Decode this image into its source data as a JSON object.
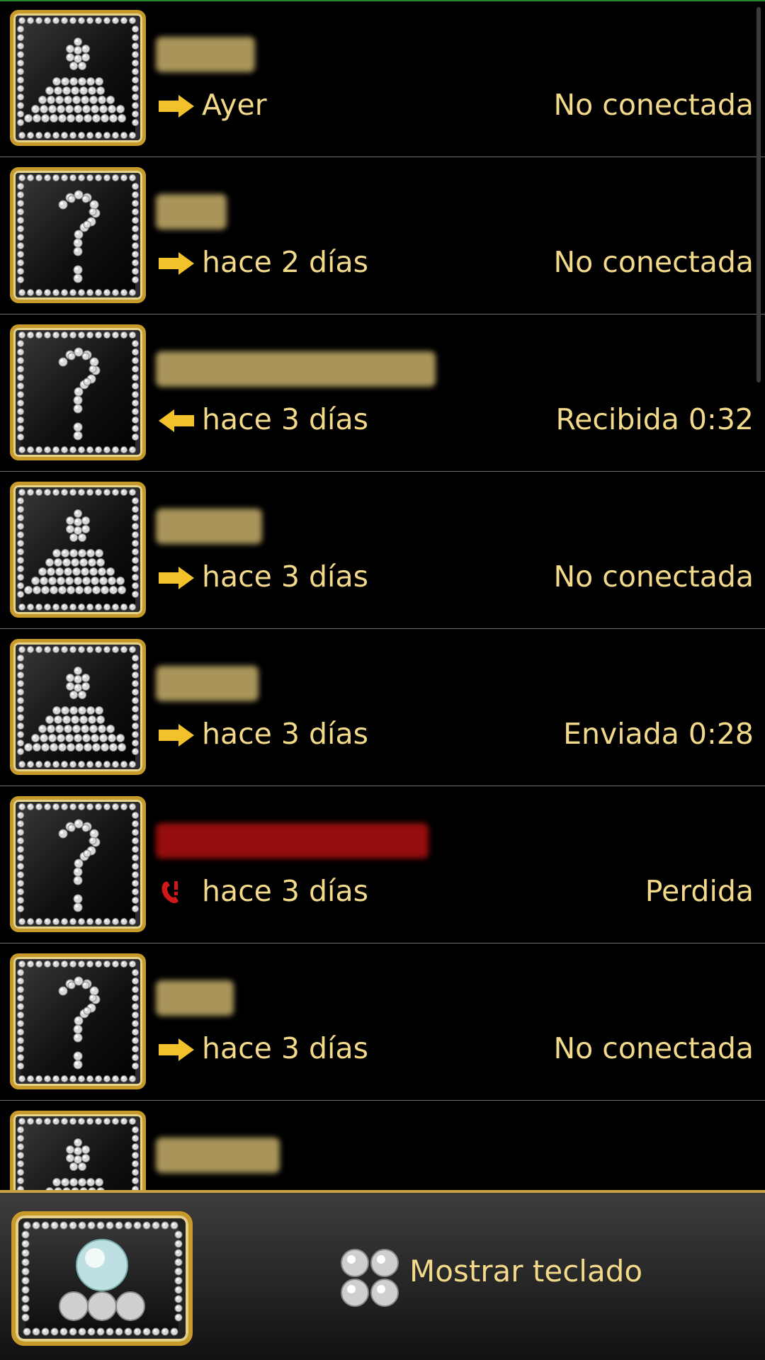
{
  "calls": [
    {
      "time": "Ayer",
      "status": "No conectada",
      "type": "outgoing",
      "avatar": "person-icon",
      "name_color": "#c7b06a"
    },
    {
      "time": "hace 2 días",
      "status": "No conectada",
      "type": "outgoing",
      "avatar": "unknown-icon",
      "name_color": "#c7b06a"
    },
    {
      "time": "hace 3 días",
      "status": "Recibida 0:32",
      "type": "incoming",
      "avatar": "unknown-icon",
      "name_color": "#c7b06a"
    },
    {
      "time": "hace 3 días",
      "status": "No conectada",
      "type": "outgoing",
      "avatar": "person-icon",
      "name_color": "#c7b06a"
    },
    {
      "time": "hace 3 días",
      "status": "Enviada 0:28",
      "type": "outgoing",
      "avatar": "person-icon",
      "name_color": "#c7b06a"
    },
    {
      "time": "hace 3 días",
      "status": "Perdida",
      "type": "missed",
      "avatar": "unknown-icon",
      "name_color": "#b01010"
    },
    {
      "time": "hace 3 días",
      "status": "No conectada",
      "type": "outgoing",
      "avatar": "unknown-icon",
      "name_color": "#c7b06a"
    },
    {
      "time": "",
      "status": "",
      "type": "",
      "avatar": "person-icon",
      "name_color": "#c7b06a"
    }
  ],
  "bottom_bar": {
    "show_keypad_label": "Mostrar teclado"
  },
  "colors": {
    "accent_gold": "#f3d98a",
    "arrow_gold": "#f3c22a",
    "missed_red": "#d01818",
    "frame_gold": "#c79a2a"
  }
}
